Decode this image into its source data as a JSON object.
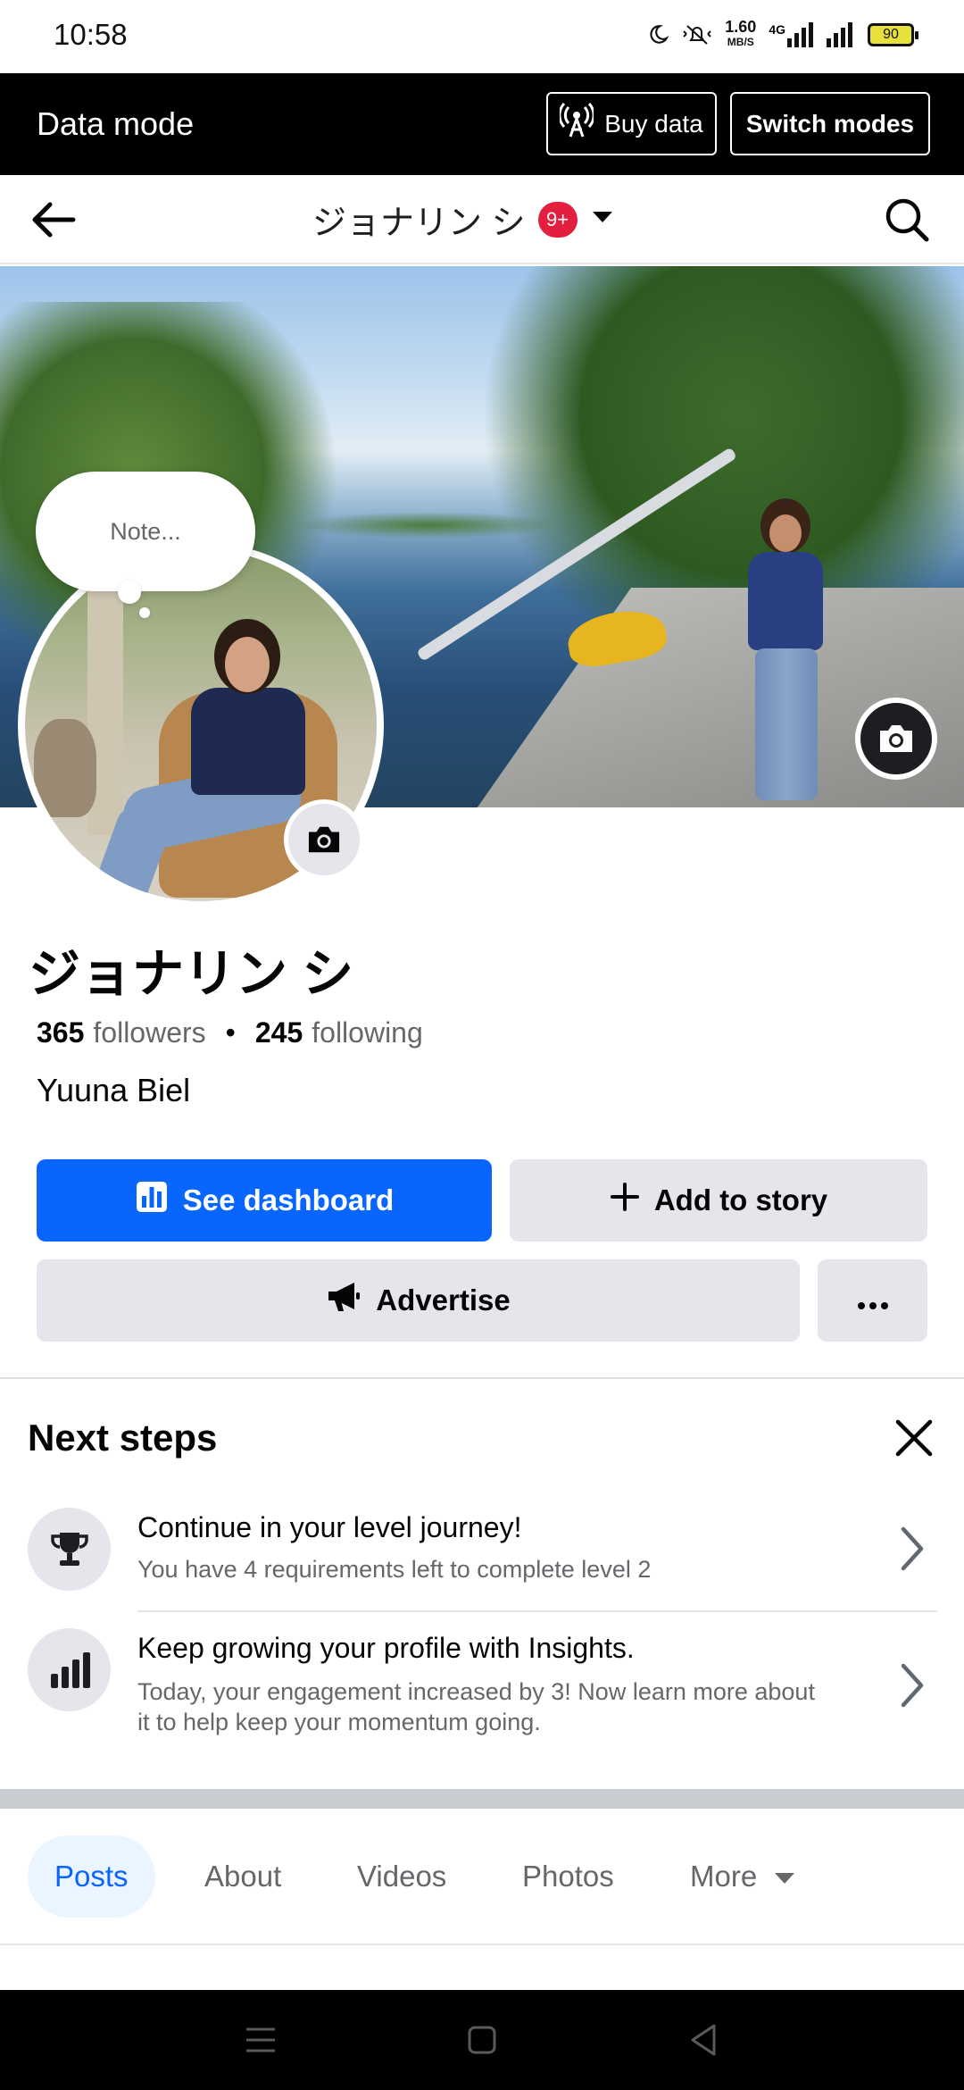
{
  "status_bar": {
    "time": "10:58",
    "net_speed_value": "1.60",
    "net_speed_unit": "MB/S",
    "network_type": "4G",
    "battery": "90"
  },
  "data_mode_bar": {
    "title": "Data mode",
    "buy_data_label": "Buy data",
    "switch_modes_label": "Switch modes"
  },
  "top_nav": {
    "title": "ジョナリン シ",
    "notification_badge": "9+"
  },
  "profile": {
    "note_placeholder": "Note...",
    "name": "ジョナリン シ",
    "followers_count": "365",
    "followers_label": "followers",
    "following_count": "245",
    "following_label": "following",
    "bio": "Yuuna Biel"
  },
  "actions": {
    "dashboard_label": "See dashboard",
    "add_story_label": "Add to story",
    "advertise_label": "Advertise"
  },
  "next_steps": {
    "title": "Next steps",
    "items": [
      {
        "title": "Continue in your level journey!",
        "subtitle": "You have 4 requirements left to complete level 2",
        "icon": "trophy-icon"
      },
      {
        "title": "Keep growing your profile with Insights.",
        "subtitle": "Today, your engagement increased by 3! Now learn more about it to help keep your momentum going.",
        "icon": "bar-chart-icon"
      }
    ]
  },
  "tabs": [
    {
      "label": "Posts",
      "active": true
    },
    {
      "label": "About"
    },
    {
      "label": "Videos"
    },
    {
      "label": "Photos"
    },
    {
      "label": "More"
    }
  ],
  "colors": {
    "accent": "#0866ff",
    "badge": "#e41e3f",
    "button_gray": "#e4e6eb"
  }
}
